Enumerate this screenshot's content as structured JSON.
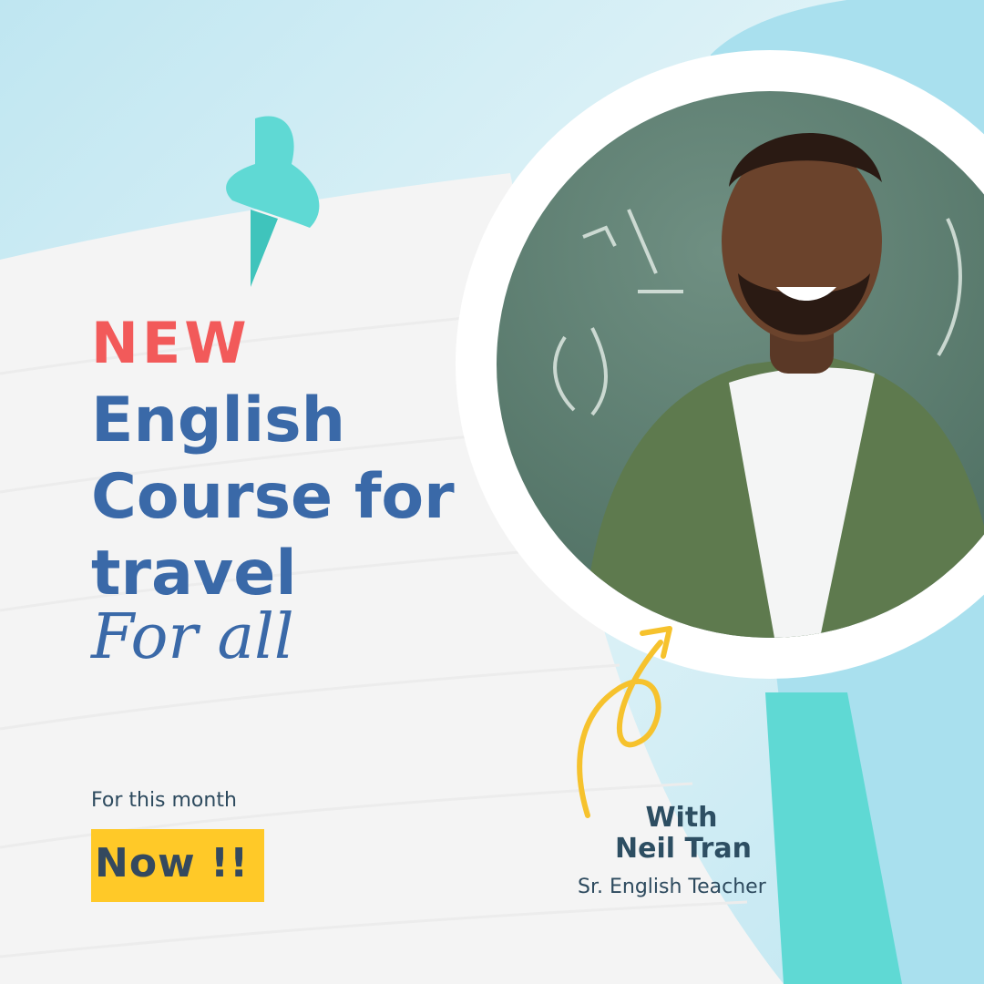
{
  "poster": {
    "badge": "NEW",
    "title_lines": [
      "English",
      "Course for",
      "travel"
    ],
    "subtitle": "For all",
    "promo_label": "For this month",
    "cta": "Now !!",
    "teacher": {
      "with": "With",
      "name": "Neil Tran",
      "role": "Sr. English Teacher"
    }
  },
  "colors": {
    "sky": "#cdebf4",
    "paper": "#f4f4f4",
    "teal": "#5fd9d4",
    "accent_red": "#f25a5a",
    "title_blue": "#3a69a8",
    "highlight_yellow": "#ffc928",
    "dark_text": "#2d4e62"
  },
  "icons": {
    "pushpin": "pushpin-icon",
    "arrow": "curly-arrow-icon"
  }
}
